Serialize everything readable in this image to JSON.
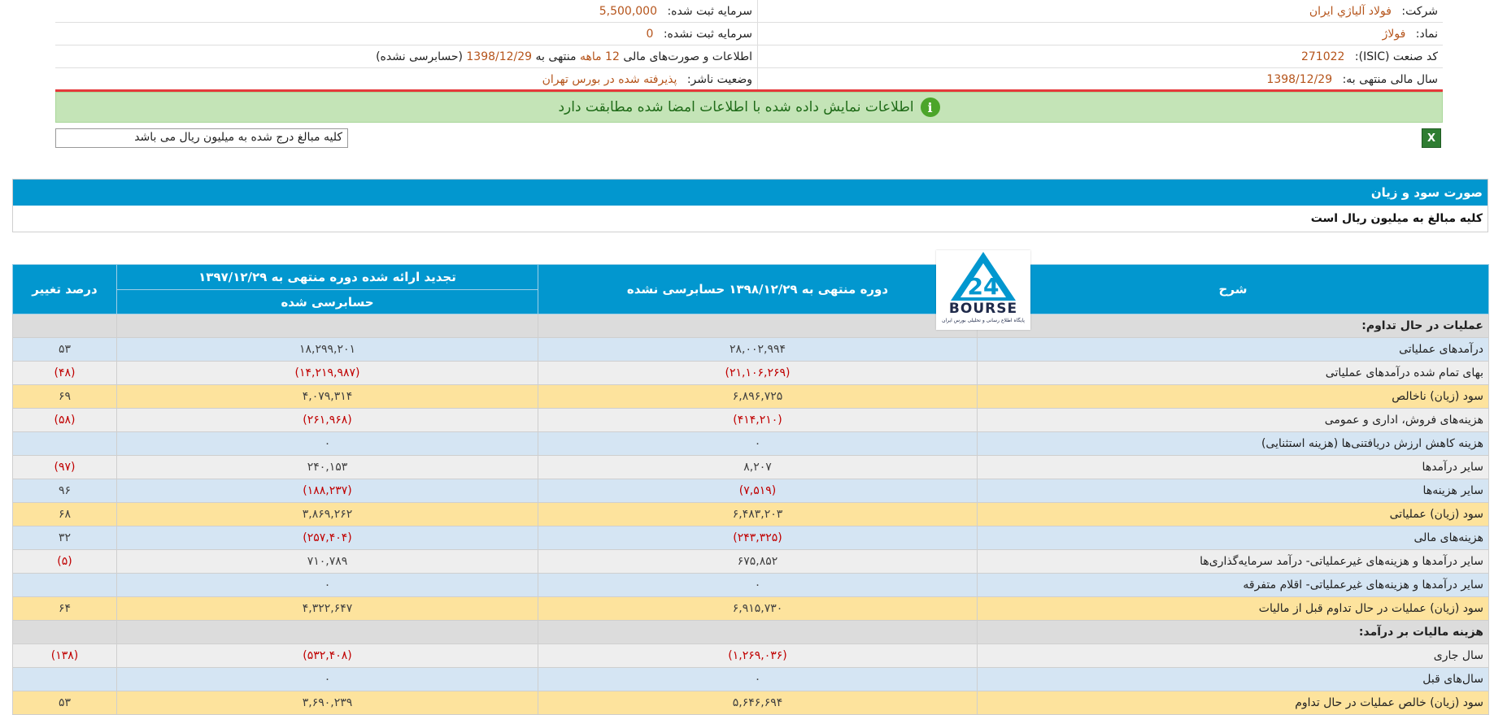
{
  "company_info": {
    "company_label": "شرکت:",
    "company_value": "فولاد آلياژي ايران",
    "registered_capital_label": "سرمایه ثبت شده:",
    "registered_capital_value": "5,500,000",
    "symbol_label": "نماد:",
    "symbol_value": "فولاژ",
    "unregistered_capital_label": "سرمایه ثبت نشده:",
    "unregistered_capital_value": "0",
    "isic_label": "کد صنعت (ISIC):",
    "isic_value": "271022",
    "report_prefix": "اطلاعات و صورت‌های مالی",
    "report_period": "12 ماهه",
    "report_middle": "منتهی به",
    "report_date": "1398/12/29",
    "report_status": "(حسابرسی نشده)",
    "fiscal_year_label": "سال مالی منتهی به:",
    "fiscal_year_value": "1398/12/29",
    "publisher_status_label": "وضعیت ناشر:",
    "publisher_status_value": "پذیرفته شده در بورس تهران"
  },
  "verification_banner": "اطلاعات نمایش داده شده با اطلاعات امضا شده مطابقت دارد",
  "unit_note": "کلیه مبالغ درج شده به میلیون ریال می باشد",
  "excel_icon_label": "X",
  "section": {
    "title": "صورت سود و زیان",
    "subtitle": "کلیه مبالغ به میلیون ریال است"
  },
  "logo": {
    "word": "BOURSE",
    "digits": "24",
    "tagline": "پایگاه اطلاع رسانی و تحلیلی بورس ایران"
  },
  "table": {
    "headers": {
      "desc": "شرح",
      "current": "دوره منتهی به ۱۳۹۸/۱۲/۲۹ حسابرسی نشده",
      "previous": "تجدید ارائه شده دوره منتهی به ۱۳۹۷/۱۲/۲۹",
      "previous_sub": "حسابرسی شده",
      "change": "درصد تغییر"
    },
    "rows": [
      {
        "style": "sec",
        "desc": "عملیات در حال تداوم:",
        "current": "",
        "previous": "",
        "change": ""
      },
      {
        "style": "blue",
        "desc": "درآمدهای عملیاتی",
        "current": "۲۸,۰۰۲,۹۹۴",
        "previous": "۱۸,۲۹۹,۲۰۱",
        "change": "۵۳"
      },
      {
        "style": "grey",
        "desc": "بهاى تمام شده درآمدهای عملیاتی",
        "current": "(۲۱,۱۰۶,۲۶۹)",
        "previous": "(۱۴,۲۱۹,۹۸۷)",
        "change": "(۴۸)"
      },
      {
        "style": "yel",
        "desc": "سود (زیان) ناخالص",
        "current": "۶,۸۹۶,۷۲۵",
        "previous": "۴,۰۷۹,۳۱۴",
        "change": "۶۹"
      },
      {
        "style": "grey",
        "desc": "هزینه‌های فروش، اداری و عمومی",
        "current": "(۴۱۴,۲۱۰)",
        "previous": "(۲۶۱,۹۶۸)",
        "change": "(۵۸)"
      },
      {
        "style": "blue",
        "desc": "هزینه کاهش ارزش دریافتنی‌ها (هزینه استثنایی)",
        "current": "۰",
        "previous": "۰",
        "change": ""
      },
      {
        "style": "grey",
        "desc": "سایر درآمدها",
        "current": "۸,۲۰۷",
        "previous": "۲۴۰,۱۵۳",
        "change": "(۹۷)"
      },
      {
        "style": "blue",
        "desc": "سایر هزینه‌ها",
        "current": "(۷,۵۱۹)",
        "previous": "(۱۸۸,۲۳۷)",
        "change": "۹۶"
      },
      {
        "style": "yel",
        "desc": "سود (زیان) عملیاتی",
        "current": "۶,۴۸۳,۲۰۳",
        "previous": "۳,۸۶۹,۲۶۲",
        "change": "۶۸"
      },
      {
        "style": "blue",
        "desc": "هزینه‌های مالی",
        "current": "(۲۴۳,۳۲۵)",
        "previous": "(۲۵۷,۴۰۴)",
        "change": "۳۲"
      },
      {
        "style": "grey",
        "desc": "سایر درآمدها و هزینه‌های غیرعملیاتی- درآمد سرمایه‌گذاری‌ها",
        "current": "۶۷۵,۸۵۲",
        "previous": "۷۱۰,۷۸۹",
        "change": "(۵)"
      },
      {
        "style": "blue",
        "desc": "سایر درآمدها و هزینه‌های غیرعملیاتی- اقلام متفرقه",
        "current": "۰",
        "previous": "۰",
        "change": ""
      },
      {
        "style": "yel",
        "desc": "سود (زیان) عملیات در حال تداوم قبل از مالیات",
        "current": "۶,۹۱۵,۷۳۰",
        "previous": "۴,۳۲۲,۶۴۷",
        "change": "۶۴"
      },
      {
        "style": "sec",
        "desc": "هزینه مالیات بر درآمد:",
        "current": "",
        "previous": "",
        "change": ""
      },
      {
        "style": "grey",
        "desc": "سال جاری",
        "current": "(۱,۲۶۹,۰۳۶)",
        "previous": "(۵۳۲,۴۰۸)",
        "change": "(۱۳۸)"
      },
      {
        "style": "blue",
        "desc": "سال‌های قبل",
        "current": "۰",
        "previous": "۰",
        "change": ""
      },
      {
        "style": "yel",
        "desc": "سود (زیان) خالص عملیات در حال تداوم",
        "current": "۵,۶۴۶,۶۹۴",
        "previous": "۳,۶۹۰,۲۳۹",
        "change": "۵۳"
      }
    ]
  }
}
